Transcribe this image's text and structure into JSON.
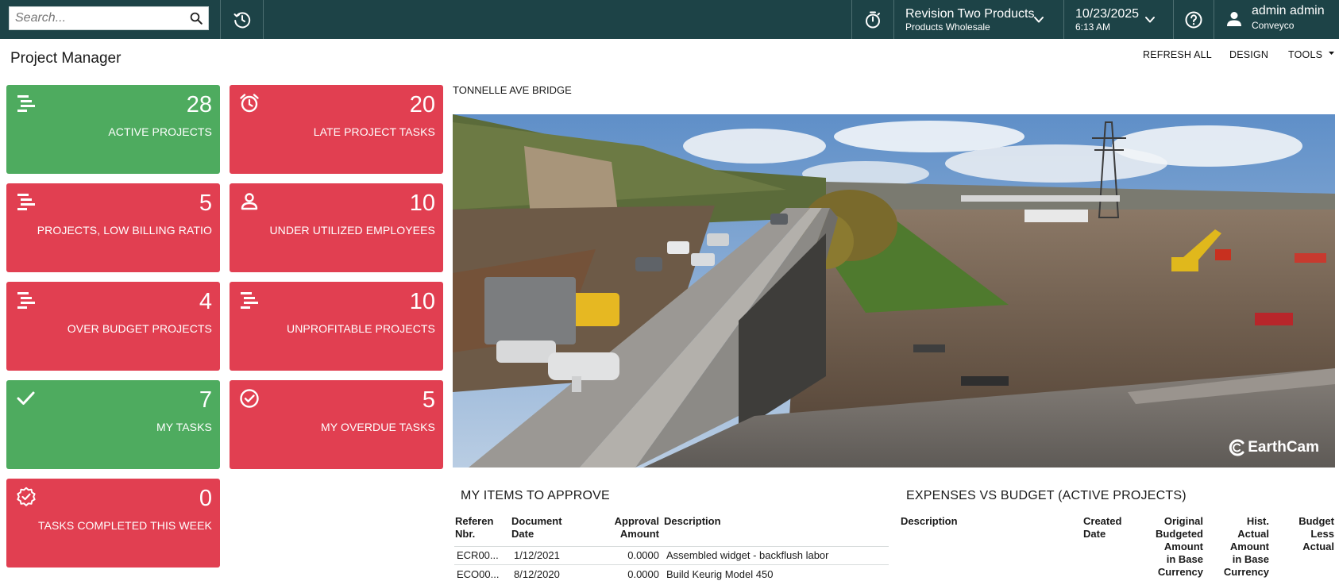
{
  "topbar": {
    "search_placeholder": "Search...",
    "branch_name": "Revision Two Products",
    "branch_sub": "Products Wholesale",
    "date": "10/23/2025",
    "time": "6:13 AM",
    "user_name": "admin admin",
    "user_company": "Conveyco",
    "icons": [
      "search-icon",
      "history-icon",
      "timer-icon",
      "chevron-down-icon",
      "help-icon",
      "user-icon"
    ]
  },
  "header": {
    "title": "Project Manager",
    "refresh_all": "REFRESH ALL",
    "design": "DESIGN",
    "tools": "TOOLS"
  },
  "tiles": [
    {
      "count": "28",
      "label": "ACTIVE PROJECTS",
      "color": "#4eab5f",
      "icon": "projects-icon"
    },
    {
      "count": "20",
      "label": "LATE PROJECT TASKS",
      "color": "#e13f51",
      "icon": "alarm-clock-icon"
    },
    {
      "count": "5",
      "label": "PROJECTS, LOW BILLING RATIO",
      "color": "#e13f51",
      "icon": "projects-icon"
    },
    {
      "count": "10",
      "label": "UNDER UTILIZED EMPLOYEES",
      "color": "#e13f51",
      "icon": "person-icon"
    },
    {
      "count": "4",
      "label": "OVER BUDGET PROJECTS",
      "color": "#e13f51",
      "icon": "projects-icon"
    },
    {
      "count": "10",
      "label": "UNPROFITABLE PROJECTS",
      "color": "#e13f51",
      "icon": "projects-icon"
    },
    {
      "count": "7",
      "label": "MY TASKS",
      "color": "#4eab5f",
      "icon": "checkmark-icon"
    },
    {
      "count": "5",
      "label": "MY OVERDUE TASKS",
      "color": "#e13f51",
      "icon": "check-circle-icon"
    },
    {
      "count": "0",
      "label": "TASKS COMPLETED THIS WEEK",
      "color": "#e13f51",
      "icon": "verified-badge-icon"
    }
  ],
  "photo": {
    "title": "TONNELLE AVE BRIDGE",
    "watermark": "EarthCam"
  },
  "approve": {
    "title": "MY ITEMS TO APPROVE",
    "headers": {
      "ref_1": "Referen",
      "ref_2": "Nbr.",
      "doc_1": "Document",
      "doc_2": "Date",
      "amt_1": "Approval",
      "amt_2": "Amount",
      "desc": "Description"
    },
    "rows": [
      {
        "ref": "ECR00...",
        "date": "1/12/2021",
        "amount": "0.0000",
        "desc": "Assembled widget - backflush labor"
      },
      {
        "ref": "ECO00...",
        "date": "8/12/2020",
        "amount": "0.0000",
        "desc": "Build Keurig Model 450"
      }
    ]
  },
  "expenses": {
    "title": "EXPENSES VS BUDGET (ACTIVE PROJECTS)",
    "headers": {
      "desc": "Description",
      "created_1": "Created",
      "created_2": "Date",
      "orig_1": "Original",
      "orig_2": "Budgeted",
      "orig_3": "Amount",
      "orig_4": "in Base",
      "orig_5": "Currency",
      "hist_1": "Hist.",
      "hist_2": "Actual",
      "hist_3": "Amount",
      "hist_4": "in Base",
      "hist_5": "Currency",
      "bla_1": "Budget",
      "bla_2": "Less",
      "bla_3": "Actual"
    }
  }
}
